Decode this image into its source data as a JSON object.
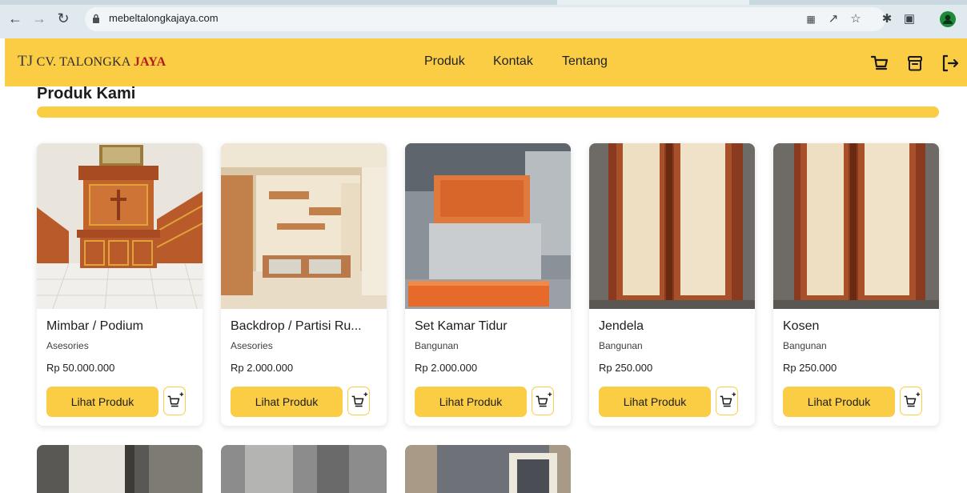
{
  "browser": {
    "url": "mebeltalongkajaya.com"
  },
  "header": {
    "logo_mark": "TJ",
    "logo_name": "CV. TALONGKA",
    "logo_accent": "JAYA",
    "nav": [
      "Produk",
      "Kontak",
      "Tentang"
    ]
  },
  "section": {
    "title": "Produk Kami"
  },
  "products": [
    {
      "name": "Mimbar / Podium",
      "category": "Asesories",
      "price": "Rp 50.000.000",
      "button": "Lihat Produk"
    },
    {
      "name": "Backdrop / Partisi Ru...",
      "category": "Asesories",
      "price": "Rp 2.000.000",
      "button": "Lihat Produk"
    },
    {
      "name": "Set Kamar Tidur",
      "category": "Bangunan",
      "price": "Rp 2.000.000",
      "button": "Lihat Produk"
    },
    {
      "name": "Jendela",
      "category": "Bangunan",
      "price": "Rp 250.000",
      "button": "Lihat Produk"
    },
    {
      "name": "Kosen",
      "category": "Bangunan",
      "price": "Rp 250.000",
      "button": "Lihat Produk"
    }
  ],
  "colors": {
    "brand_yellow": "#fbcd45",
    "logo_accent_red": "#b31b1b"
  },
  "icons": {
    "header": [
      "cart-icon",
      "archive-icon",
      "logout-icon"
    ],
    "card": "add-to-cart-icon"
  }
}
